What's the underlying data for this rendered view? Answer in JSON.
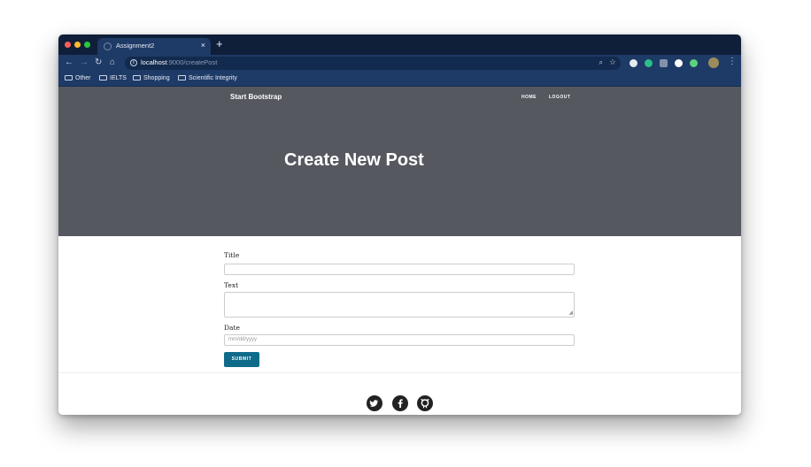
{
  "browser": {
    "tab_title": "Assignment2",
    "tab_close": "×",
    "new_tab": "+",
    "url_host": "localhost",
    "url_path": ":9000/createPost",
    "bookmarks": [
      "Other",
      "IELTS",
      "Shopping",
      "Scientific Integrity"
    ]
  },
  "navbar": {
    "brand": "Start Bootstrap",
    "links": [
      "HOME",
      "LOGOUT"
    ]
  },
  "hero": {
    "title": "Create New Post",
    "background": "#565860"
  },
  "form": {
    "title_label": "Title",
    "title_value": "",
    "text_label": "Text",
    "text_value": "",
    "date_label": "Date",
    "date_placeholder": "mm/dd/yyyy",
    "submit_label": "SUBMIT",
    "accent": "#0f6b8a"
  },
  "footer": {
    "social_icons": [
      "twitter-icon",
      "facebook-icon",
      "github-icon"
    ]
  }
}
